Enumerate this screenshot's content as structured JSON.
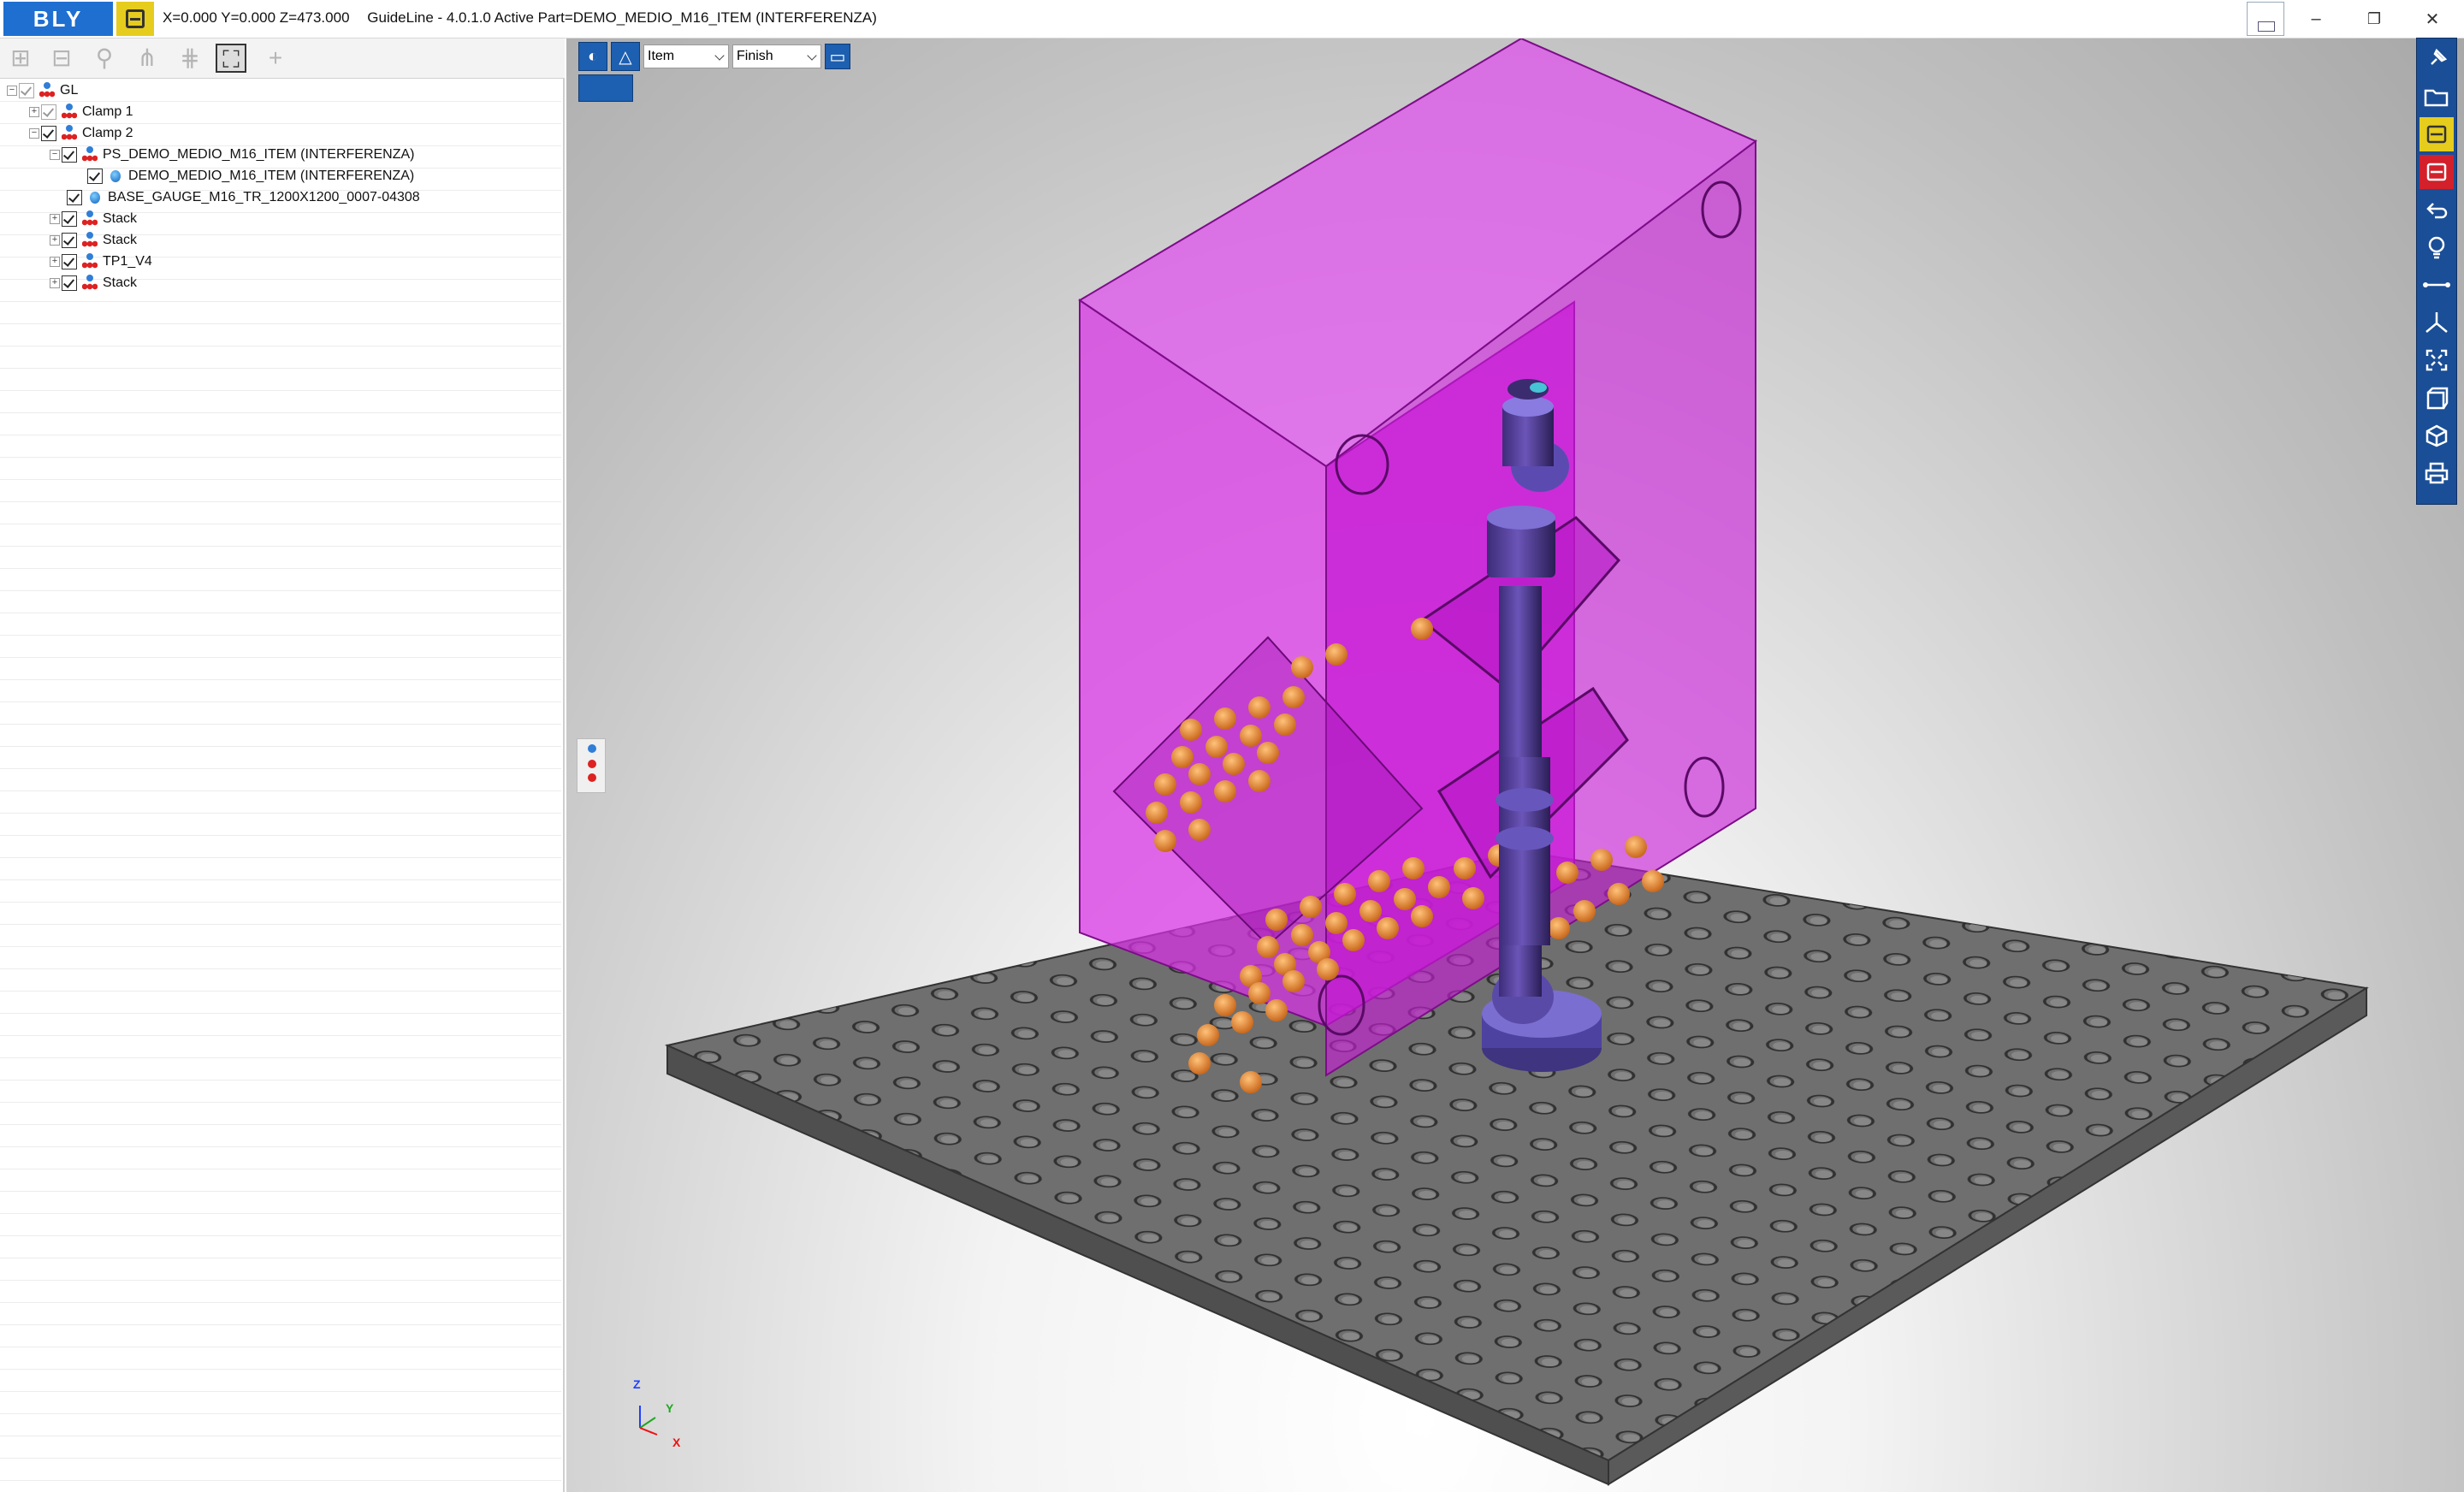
{
  "titlebar": {
    "logo_text": "BLY",
    "coords": "X=0.000 Y=0.000 Z=473.000",
    "app_title": "GuideLine - 4.0.1.0 Active Part=DEMO_MEDIO_M16_ITEM (INTERFERENZA)",
    "minimize": "–",
    "restore": "❐",
    "close": "✕"
  },
  "tree": {
    "rows": [
      {
        "label": "GL"
      },
      {
        "label": "Clamp 1"
      },
      {
        "label": "Clamp 2"
      },
      {
        "label": "PS_DEMO_MEDIO_M16_ITEM (INTERFERENZA)"
      },
      {
        "label": "DEMO_MEDIO_M16_ITEM (INTERFERENZA)"
      },
      {
        "label": "BASE_GAUGE_M16_TR_1200X1200_0007-04308"
      },
      {
        "label": "Stack"
      },
      {
        "label": "Stack"
      },
      {
        "label": "TP1_V4"
      },
      {
        "label": "Stack"
      }
    ]
  },
  "viewport": {
    "mode_select": "Item",
    "finish_select": "Finish",
    "axes": {
      "z": "Z",
      "y": "Y",
      "x": "X"
    }
  },
  "colors": {
    "brand_blue": "#1e6fd0",
    "brand_yellow": "#e6cc1d",
    "part_magenta": "#d21be0",
    "base_plate": "#6e6e6e",
    "toolbar_blue": "#1a4e96"
  },
  "icons": {
    "right_toolbar": [
      "pin-icon",
      "open-folder-icon",
      "yellow-part-icon",
      "red-part-icon",
      "undo-icon",
      "lightbulb-icon",
      "measure-icon",
      "axes-icon",
      "fit-view-icon",
      "view-cube-icon",
      "iso-view-icon",
      "print-icon"
    ]
  }
}
